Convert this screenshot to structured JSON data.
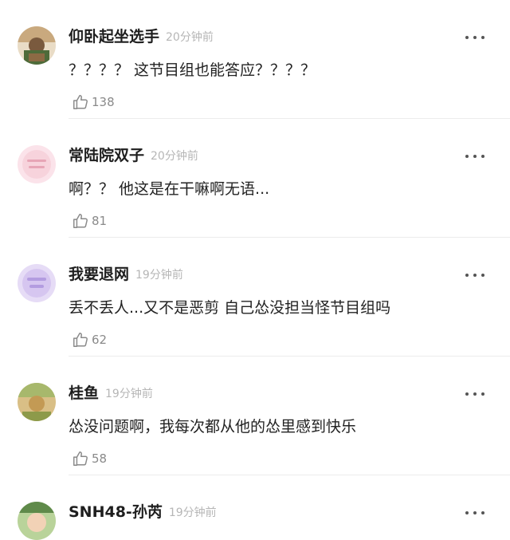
{
  "comments": [
    {
      "username": "仰卧起坐选手",
      "time": "20分钟前",
      "text": "？？？？ 这节目组也能答应？？？？",
      "likes": "138",
      "avatar_color": "#7a5a3e"
    },
    {
      "username": "常陆院双子",
      "time": "20分钟前",
      "text": "啊？？ 他这是在干嘛啊无语...",
      "likes": "81",
      "avatar_color": "#f4c9d2"
    },
    {
      "username": "我要退网",
      "time": "19分钟前",
      "text": "丢不丢人...又不是恶剪 自己怂没担当怪节目组吗",
      "likes": "62",
      "avatar_color": "#c9b6e6"
    },
    {
      "username": "桂鱼",
      "time": "19分钟前",
      "text": "怂没问题啊，我每次都从他的怂里感到快乐",
      "likes": "58",
      "avatar_color": "#c39a54"
    },
    {
      "username": "SNH48-孙芮",
      "time": "19分钟前",
      "avatar_color": "#5f8a4a"
    }
  ],
  "icons": {
    "like": "thumbs-up-icon",
    "more": "more-dots-icon"
  }
}
